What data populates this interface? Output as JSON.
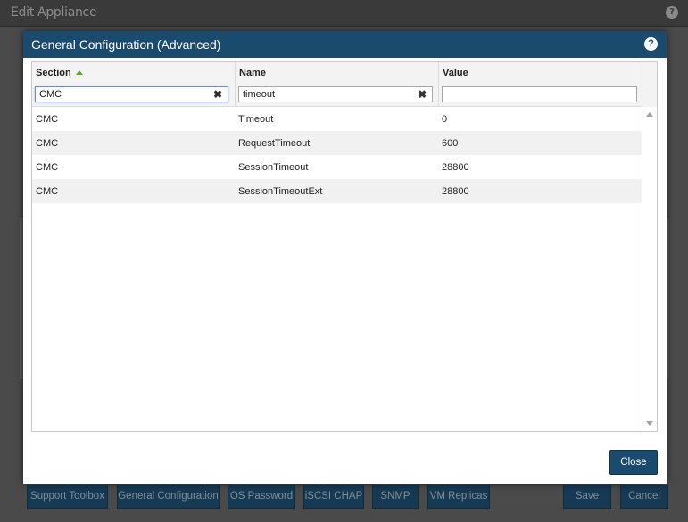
{
  "outer_window": {
    "title": "Edit Appliance",
    "help_glyph": "?"
  },
  "footer": {
    "buttons": [
      "Support Toolbox",
      "General Configuration",
      "OS Password",
      "iSCSI CHAP",
      "SNMP",
      "VM Replicas"
    ],
    "save_label": "Save",
    "cancel_label": "Cancel"
  },
  "dialog": {
    "title": "General Configuration (Advanced)",
    "help_glyph": "?",
    "close_label": "Close"
  },
  "grid": {
    "columns": [
      {
        "label": "Section",
        "sorted": "asc",
        "filter_value": "CMC",
        "filter_placeholder": ""
      },
      {
        "label": "Name",
        "sorted": "",
        "filter_value": "timeout",
        "filter_placeholder": ""
      },
      {
        "label": "Value",
        "sorted": "",
        "filter_value": "",
        "filter_placeholder": ""
      }
    ],
    "rows": [
      {
        "section": "CMC",
        "name": "Timeout",
        "value": "0"
      },
      {
        "section": "CMC",
        "name": "RequestTimeout",
        "value": "600"
      },
      {
        "section": "CMC",
        "name": "SessionTimeout",
        "value": "28800"
      },
      {
        "section": "CMC",
        "name": "SessionTimeoutExt",
        "value": "28800"
      }
    ],
    "clear_glyph": "✖"
  },
  "colors": {
    "dialog_header": "#1a4a6e",
    "button_bg": "#1a4a6e",
    "sort_indicator": "#5ba130",
    "overlay_bg": "#4a4a4a"
  }
}
